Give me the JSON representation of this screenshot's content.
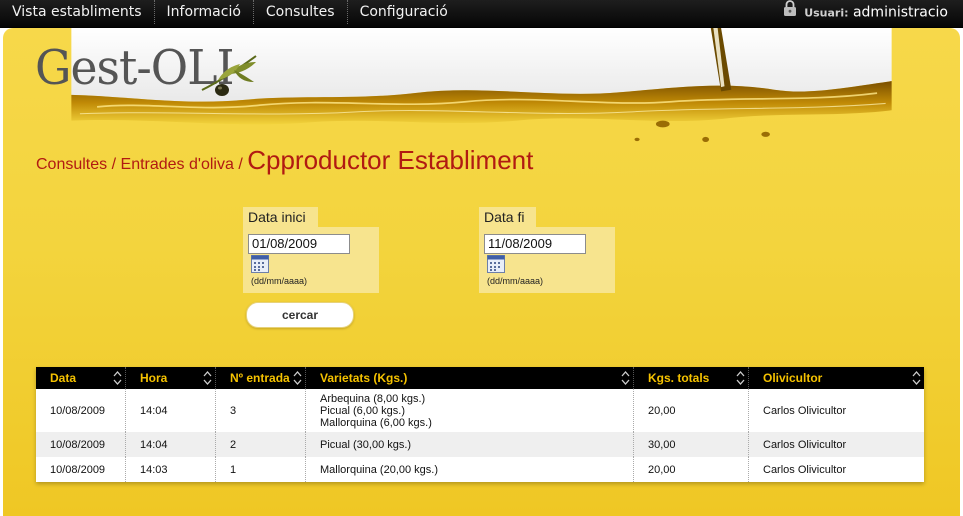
{
  "nav": {
    "items": [
      "Vista establiments",
      "Informació",
      "Consultes",
      "Configuració"
    ],
    "user_label": "Usuari:",
    "user_name": "administracio"
  },
  "logo": {
    "text": "Gest-OLI"
  },
  "breadcrumb": {
    "items": [
      "Consultes",
      "Entrades d'oliva"
    ],
    "separator": "/",
    "current": "Cpproductor Establiment"
  },
  "filters": {
    "start": {
      "label": "Data inici",
      "value": "01/08/2009",
      "format": "(dd/mm/aaaa)"
    },
    "end": {
      "label": "Data fi",
      "value": "11/08/2009",
      "format": "(dd/mm/aaaa)"
    },
    "search_label": "cercar"
  },
  "table": {
    "columns": [
      "Data",
      "Hora",
      "Nº entrada",
      "Varietats (Kgs.)",
      "Kgs. totals",
      "Olivicultor"
    ],
    "rows": [
      {
        "data": "10/08/2009",
        "hora": "14:04",
        "entrada": "3",
        "varietats": [
          "Arbequina (8,00 kgs.)",
          "Picual (6,00 kgs.)",
          "Mallorquina (6,00 kgs.)"
        ],
        "kgs": "20,00",
        "olivicultor": "Carlos Olivicultor"
      },
      {
        "data": "10/08/2009",
        "hora": "14:04",
        "entrada": "2",
        "varietats": [
          "Picual (30,00 kgs.)"
        ],
        "kgs": "30,00",
        "olivicultor": "Carlos Olivicultor"
      },
      {
        "data": "10/08/2009",
        "hora": "14:03",
        "entrada": "1",
        "varietats": [
          "Mallorquina (20,00 kgs.)"
        ],
        "kgs": "20,00",
        "olivicultor": "Carlos Olivicultor"
      }
    ]
  },
  "colors": {
    "accent_text": "#b11a12",
    "header_text": "#f5c200",
    "oil_yellow": "#f3d43d"
  },
  "icons": [
    "lock-icon",
    "calendar-icon",
    "sort-arrows-icon",
    "olive-branch-icon"
  ]
}
